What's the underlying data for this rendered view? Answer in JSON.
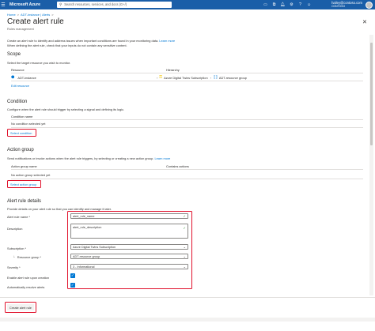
{
  "topbar": {
    "brand": "Microsoft Azure",
    "search_placeholder": "Search resources, services, and docs (G+/)",
    "user": "hailey@contoso.com",
    "tenant": "CONTOSO"
  },
  "breadcrumb": [
    "Home",
    "ADT-instance | Alerts"
  ],
  "page": {
    "title": "Create alert rule",
    "subtitle": "Rules management"
  },
  "intro": {
    "line1": "Create an alert rule to identify and address issues when important conditions are found in your monitoring data.",
    "learn_more": "Learn more",
    "line2": "When defining the alert rule, check that your inputs do not contain any sensitive content."
  },
  "scope": {
    "header": "Scope",
    "desc": "Select the target resource you wish to monitor.",
    "col_resource": "Resource",
    "col_hierarchy": "Hierarchy",
    "resource": "ADT-instance",
    "subscription": "Azure Digital Twins Subscription",
    "resource_group": "ADT-resource group",
    "edit": "Edit resource"
  },
  "condition": {
    "header": "Condition",
    "desc": "Configure when the alert rule should trigger by selecting a signal and defining its logic.",
    "col": "Condition name",
    "empty": "No condition selected yet",
    "select": "Select condition"
  },
  "action_group": {
    "header": "Action group",
    "desc": "Send notifications or invoke actions when the alert rule triggers, by selecting or creating a new action group.",
    "learn_more": "Learn more",
    "col_name": "Action group name",
    "col_actions": "Contains actions",
    "empty": "No action group selected yet",
    "select": "Select action group"
  },
  "details": {
    "header": "Alert rule details",
    "desc": "Provide details on your alert rule so that you can identify and manage it later.",
    "name_label": "Alert rule name *",
    "name_value": "alert_rule_name",
    "desc_label": "Description",
    "desc_value": "alert_rule_description",
    "sub_label": "Subscription *",
    "sub_value": "Azure Digital Twins Subscription",
    "rg_label": "Resource group *",
    "rg_value": "ADT-resource group",
    "sev_label": "Severity *",
    "sev_value": "3 - Informational",
    "enable_label": "Enable alert rule upon creation",
    "resolve_label": "Automatically resolve alerts"
  },
  "footer": {
    "create": "Create alert rule"
  },
  "colors": {
    "azure_blue": "#0078d4",
    "topbar": "#1a5ea8",
    "highlight": "#e0102a"
  }
}
